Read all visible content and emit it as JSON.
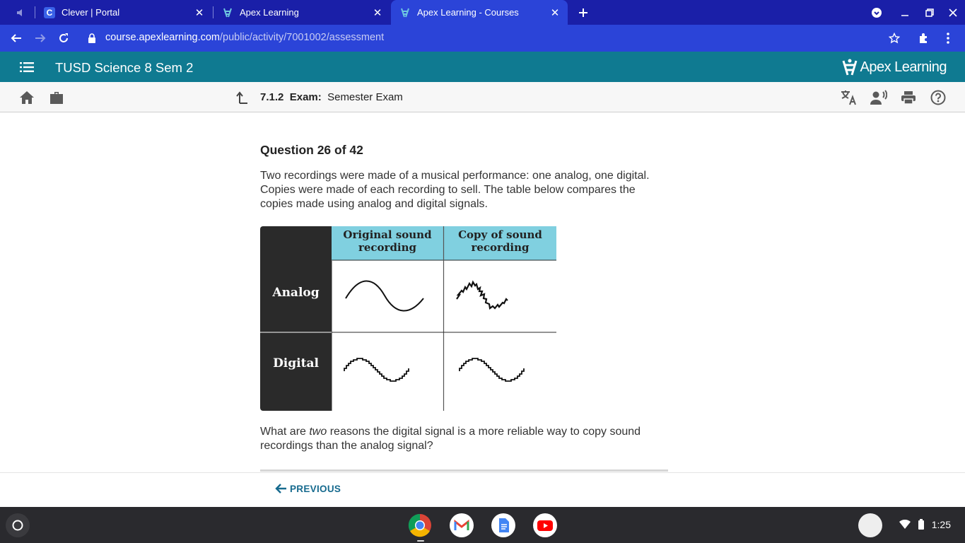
{
  "browser": {
    "tabs": [
      {
        "title": "Clever | Portal",
        "favicon": "clever-c-icon"
      },
      {
        "title": "Apex Learning",
        "favicon": "apex-icon"
      },
      {
        "title": "Apex Learning - Courses",
        "favicon": "apex-icon",
        "active": true
      }
    ],
    "url_domain": "course.apexlearning.com",
    "url_path": "/public/activity/7001002/assessment"
  },
  "header": {
    "course_title": "TUSD Science 8 Sem 2",
    "logo_text": "Apex Learning"
  },
  "activity": {
    "number": "7.1.2",
    "type": "Exam:",
    "name": "Semester Exam"
  },
  "question": {
    "number_label": "Question 26 of 42",
    "intro": "Two recordings were made of a musical performance: one analog, one digital. Copies were made of each recording to sell. The table below compares the copies made using analog and digital signals.",
    "prompt_before": "What are ",
    "prompt_em": "two",
    "prompt_after": " reasons the digital signal is a more reliable way to copy sound recordings than the analog signal?"
  },
  "figure": {
    "col_headers": [
      "Original sound recording",
      "Copy of sound recording"
    ],
    "row_labels": [
      "Analog",
      "Digital"
    ]
  },
  "footer": {
    "previous_label": "PREVIOUS"
  },
  "system": {
    "time": "1:25"
  },
  "colors": {
    "tab_strip": "#1a1fa8",
    "toolbar": "#2b44d8",
    "apex_header": "#0f7a91",
    "table_header": "#80d0e0",
    "link": "#166a8e"
  }
}
